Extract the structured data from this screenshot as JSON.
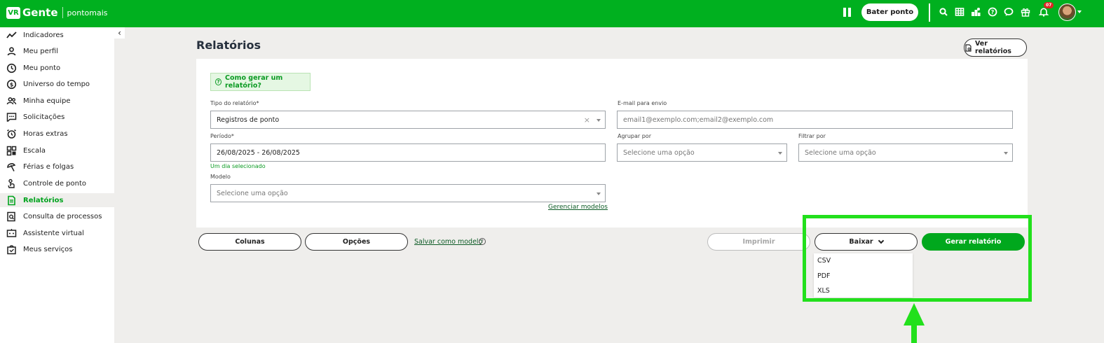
{
  "brand": {
    "logo": "VR",
    "name": "Gente",
    "product": "pontomais"
  },
  "topbar": {
    "bater_ponto": "Bater ponto",
    "notifications_count": "07",
    "icons": [
      "pause-icon",
      "search-icon",
      "calendar-grid-icon",
      "rank-icon",
      "help-icon",
      "chat-icon",
      "gift-icon",
      "bell-icon"
    ]
  },
  "sidebar": {
    "items": [
      {
        "label": "Indicadores",
        "icon": "trend-icon",
        "active": false
      },
      {
        "label": "Meu perfil",
        "icon": "user-icon",
        "active": false
      },
      {
        "label": "Meu ponto",
        "icon": "clock-icon",
        "active": false
      },
      {
        "label": "Universo do tempo",
        "icon": "dollar-icon",
        "active": false
      },
      {
        "label": "Minha equipe",
        "icon": "team-icon",
        "active": false
      },
      {
        "label": "Solicitações",
        "icon": "message-icon",
        "active": false
      },
      {
        "label": "Horas extras",
        "icon": "alarm-icon",
        "active": false
      },
      {
        "label": "Escala",
        "icon": "grid-icon",
        "active": false
      },
      {
        "label": "Férias e folgas",
        "icon": "beach-icon",
        "active": false
      },
      {
        "label": "Controle de ponto",
        "icon": "fingerprint-icon",
        "active": false
      },
      {
        "label": "Relatórios",
        "icon": "report-icon",
        "active": true
      },
      {
        "label": "Consulta de processos",
        "icon": "search-doc-icon",
        "active": false
      },
      {
        "label": "Assistente virtual",
        "icon": "bot-icon",
        "active": false
      },
      {
        "label": "Meus serviços",
        "icon": "bag-icon",
        "active": false
      }
    ]
  },
  "page": {
    "title": "Relatórios",
    "ver_relatorios": "Ver relatórios",
    "help": "Como gerar um relatório?"
  },
  "form": {
    "tipo_label": "Tipo do relatório*",
    "tipo_value": "Registros de ponto",
    "email_label": "E-mail para envio",
    "email_placeholder": "email1@exemplo.com;email2@exemplo.com",
    "periodo_label": "Período*",
    "periodo_value": "26/08/2025 - 26/08/2025",
    "periodo_hint": "Um dia selecionado",
    "agrupar_label": "Agrupar por",
    "agrupar_placeholder": "Selecione uma opção",
    "filtrar_label": "Filtrar por",
    "filtrar_placeholder": "Selecione uma opção",
    "modelo_label": "Modelo",
    "modelo_placeholder": "Selecione uma opção",
    "gerenciar_modelos": "Gerenciar modelos"
  },
  "actions": {
    "colunas": "Colunas",
    "opcoes": "Opções",
    "salvar_modelo": "Salvar como modelo",
    "imprimir": "Imprimir",
    "baixar": "Baixar",
    "gerar": "Gerar relatório",
    "baixar_options": [
      "CSV",
      "PDF",
      "XLS"
    ]
  },
  "colors": {
    "brand_green": "#00b01f",
    "highlight": "#22e01c"
  }
}
